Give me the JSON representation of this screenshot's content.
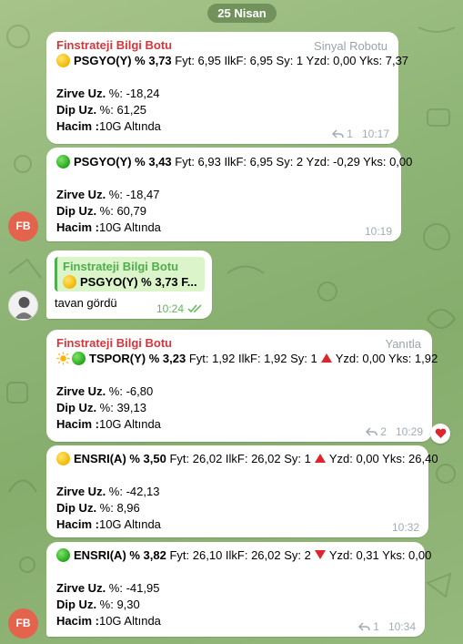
{
  "date_pill": "25 Nisan",
  "messages": [
    {
      "sender": "Finstrateji Bilgi Botu",
      "tag": "Sinyal Robotu",
      "headline_bold": "PSGYO(Y) % 3,73",
      "headline_rest": " Fyt: 6,95 IlkF: 6,95 Sy: 1 Yzd: 0,00 Yks: 7,37",
      "zirve_label": "Zirve Uz.",
      "zirve_value": " %: -18,24",
      "dip_label": "Dip Uz.",
      "dip_value": " %: 61,25",
      "hacim_label": "Hacim :",
      "hacim_value": "10G Altında",
      "replies": "1",
      "time": "10:17"
    },
    {
      "headline_bold": "PSGYO(Y) % 3,43",
      "headline_rest": " Fyt: 6,93 IlkF: 6,95 Sy: 2 Yzd: -0,29 Yks: 0,00",
      "zirve_label": "Zirve Uz.",
      "zirve_value": " %: -18,47",
      "dip_label": "Dip Uz.",
      "dip_value": " %: 60,79",
      "hacim_label": "Hacim :",
      "hacim_value": "10G Altında",
      "time": "10:19"
    },
    {
      "quote_name": "Finstrateji Bilgi Botu",
      "quote_text": "PSGYO(Y) % 3,73 F...",
      "text": "tavan gördü",
      "time": "10:24"
    },
    {
      "sender": "Finstrateji Bilgi Botu",
      "tag": "Yanıtla",
      "headline_bold": "TSPOR(Y) % 3,23",
      "headline_rest": " Fyt: 1,92 IlkF: 1,92 Sy: 1",
      "headline_tail": "Yzd: 0,00 Yks: 1,92",
      "zirve_label": "Zirve Uz.",
      "zirve_value": " %: -6,80",
      "dip_label": "Dip Uz.",
      "dip_value": " %: 39,13",
      "hacim_label": "Hacim :",
      "hacim_value": "10G Altında",
      "replies": "2",
      "time": "10:29"
    },
    {
      "headline_bold": "ENSRI(A) % 3,50",
      "headline_rest": " Fyt: 26,02 IlkF: 26,02 Sy: 1",
      "headline_tail": "Yzd: 0,00 Yks: 26,40",
      "zirve_label": "Zirve Uz.",
      "zirve_value": " %: -42,13",
      "dip_label": "Dip Uz.",
      "dip_value": " %: 8,96",
      "hacim_label": "Hacim :",
      "hacim_value": "10G Altında",
      "time": "10:32"
    },
    {
      "headline_bold": "ENSRI(A) % 3,82",
      "headline_rest": " Fyt: 26,10 IlkF: 26,02 Sy: 2",
      "headline_tail": "Yzd: 0,31 Yks: 0,00",
      "zirve_label": "Zirve Uz.",
      "zirve_value": " %: -41,95",
      "dip_label": "Dip Uz.",
      "dip_value": " %: 9,30",
      "hacim_label": "Hacim :",
      "hacim_value": "10G Altında",
      "replies": "1",
      "time": "10:34"
    }
  ],
  "avatars": {
    "bot_initials": "FB"
  },
  "colors": {
    "sender": "#d3373d",
    "quote_accent": "#4fae4e",
    "avatar_bg": "#e3634d",
    "check": "#5eb858"
  },
  "icons": {
    "status_yellow": "yellow-circle-icon",
    "status_green": "green-circle-icon",
    "arrow_up": "red-triangle-up-icon",
    "arrow_down": "red-triangle-down-icon",
    "sun": "sun-icon",
    "reply": "reply-arrow-icon",
    "read": "double-check-icon",
    "reaction": "heart-icon"
  }
}
